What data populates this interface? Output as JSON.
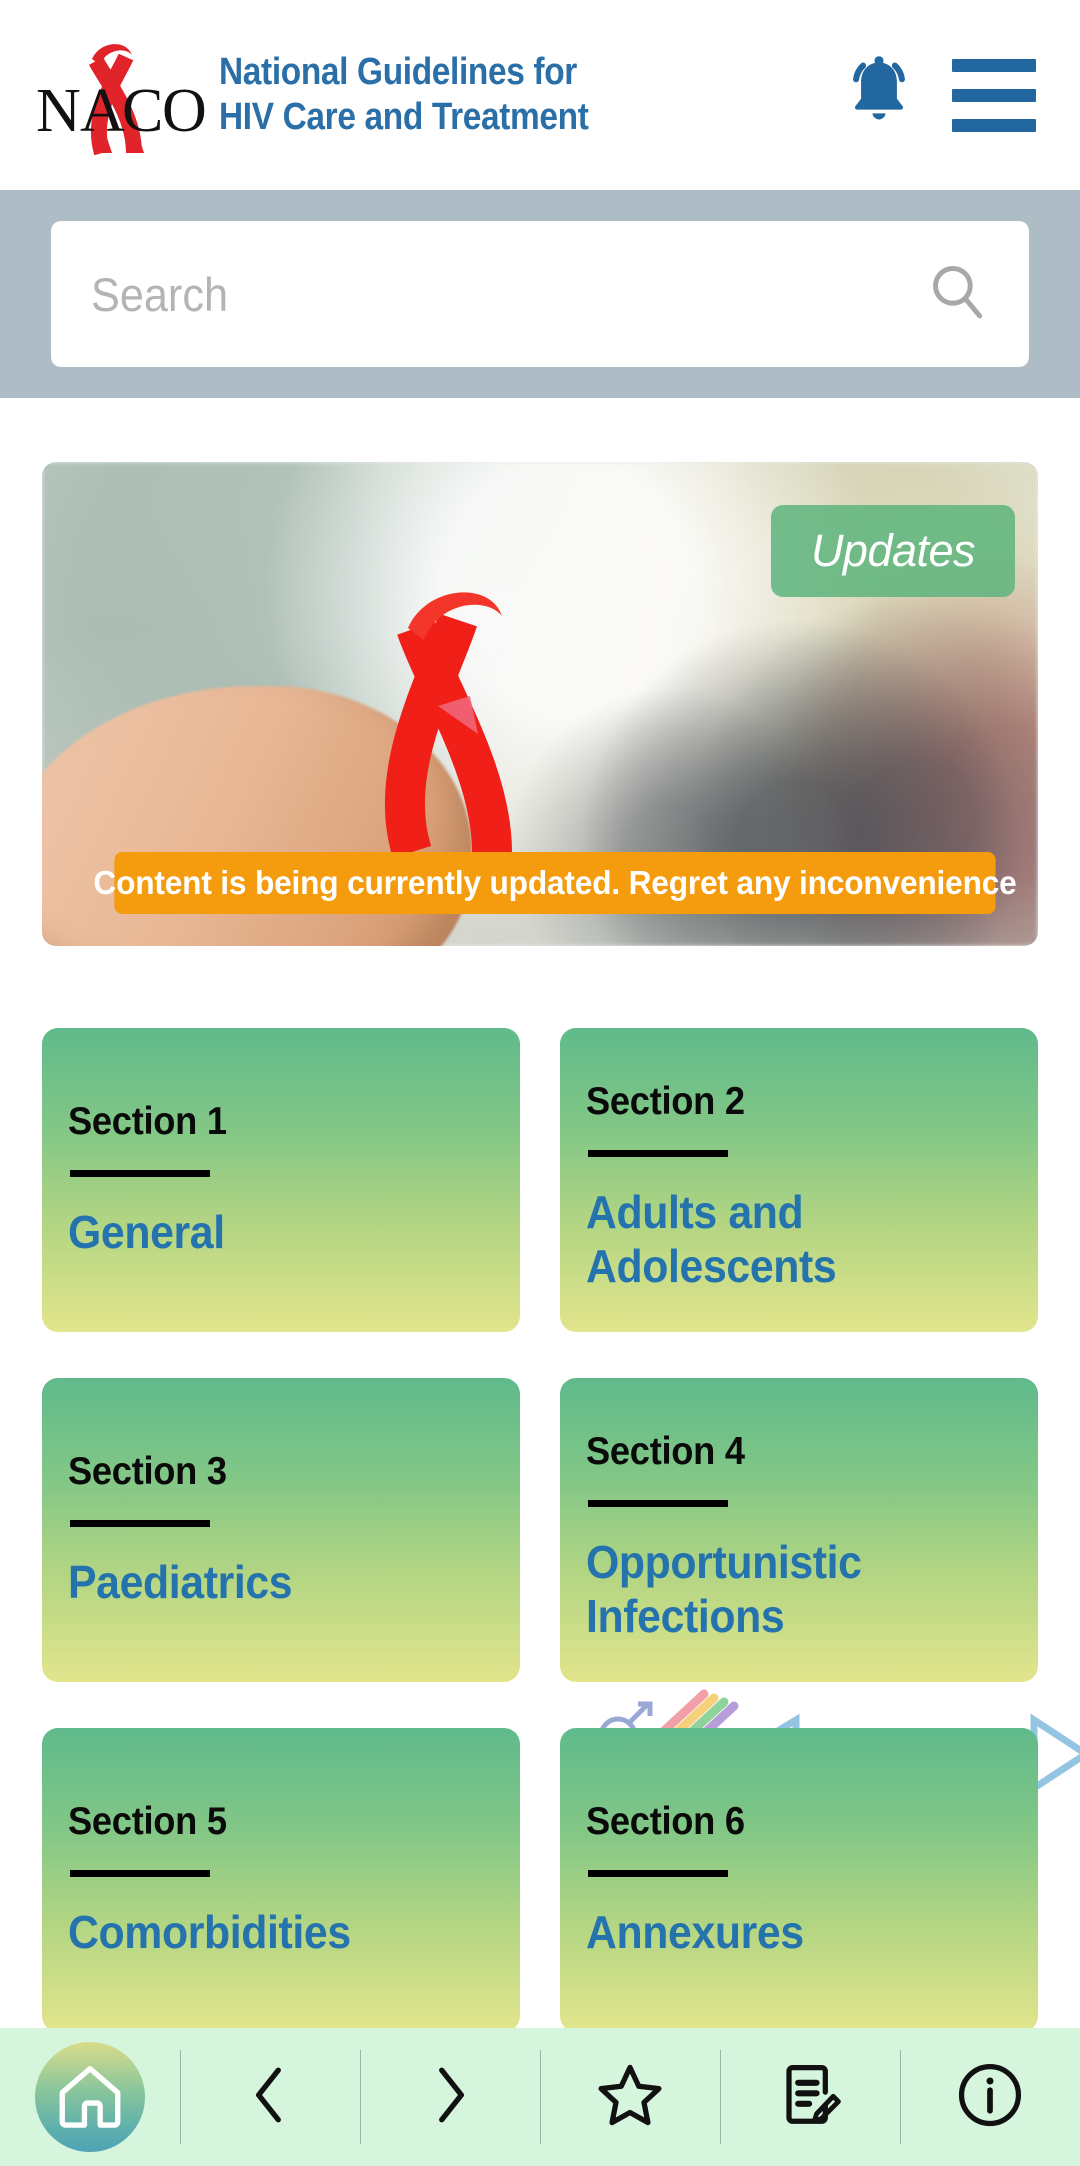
{
  "header": {
    "logo_alt": "NACO",
    "logo_text": "NACO",
    "title_line1": "National Guidelines for",
    "title_line2": "HIV Care and Treatment",
    "title_color": "#2a6fa8",
    "bell_icon": "bell-icon",
    "menu_icon": "hamburger-menu-icon"
  },
  "search": {
    "placeholder": "Search",
    "value": "",
    "icon": "search-icon",
    "band_color": "#aebcc5"
  },
  "banner": {
    "updates_label": "Updates",
    "updates_bg": "#5eb57e",
    "notice_text": "Content is being currently updated. Regret any inconvenience",
    "notice_bg": "#f59b0e",
    "image_alt": "Hand holding a red HIV awareness ribbon on a blurred street background"
  },
  "sections": [
    {
      "label": "Section 1",
      "title": "General",
      "lines": 1
    },
    {
      "label": "Section 2",
      "title": "Adults and Adolescents",
      "lines": 2
    },
    {
      "label": "Section 3",
      "title": "Paediatrics",
      "lines": 1
    },
    {
      "label": "Section 4",
      "title": "Opportunistic Infections",
      "lines": 2
    },
    {
      "label": "Section 5",
      "title": "Comorbidities",
      "lines": 1
    },
    {
      "label": "Section 6",
      "title": "Annexures",
      "lines": 1
    }
  ],
  "section_style": {
    "label_color": "#0a0a0a",
    "title_color": "#2573ad",
    "gradient_top": "#5fba8b",
    "gradient_bottom": "#e2e58c"
  },
  "bottom_nav": {
    "background": "#d6f5dd",
    "items": [
      {
        "name": "home",
        "icon": "home-icon"
      },
      {
        "name": "back",
        "icon": "chevron-left-icon"
      },
      {
        "name": "forward",
        "icon": "chevron-right-icon"
      },
      {
        "name": "favourites",
        "icon": "star-icon"
      },
      {
        "name": "notes",
        "icon": "note-edit-icon"
      },
      {
        "name": "info",
        "icon": "info-circle-icon"
      }
    ]
  }
}
